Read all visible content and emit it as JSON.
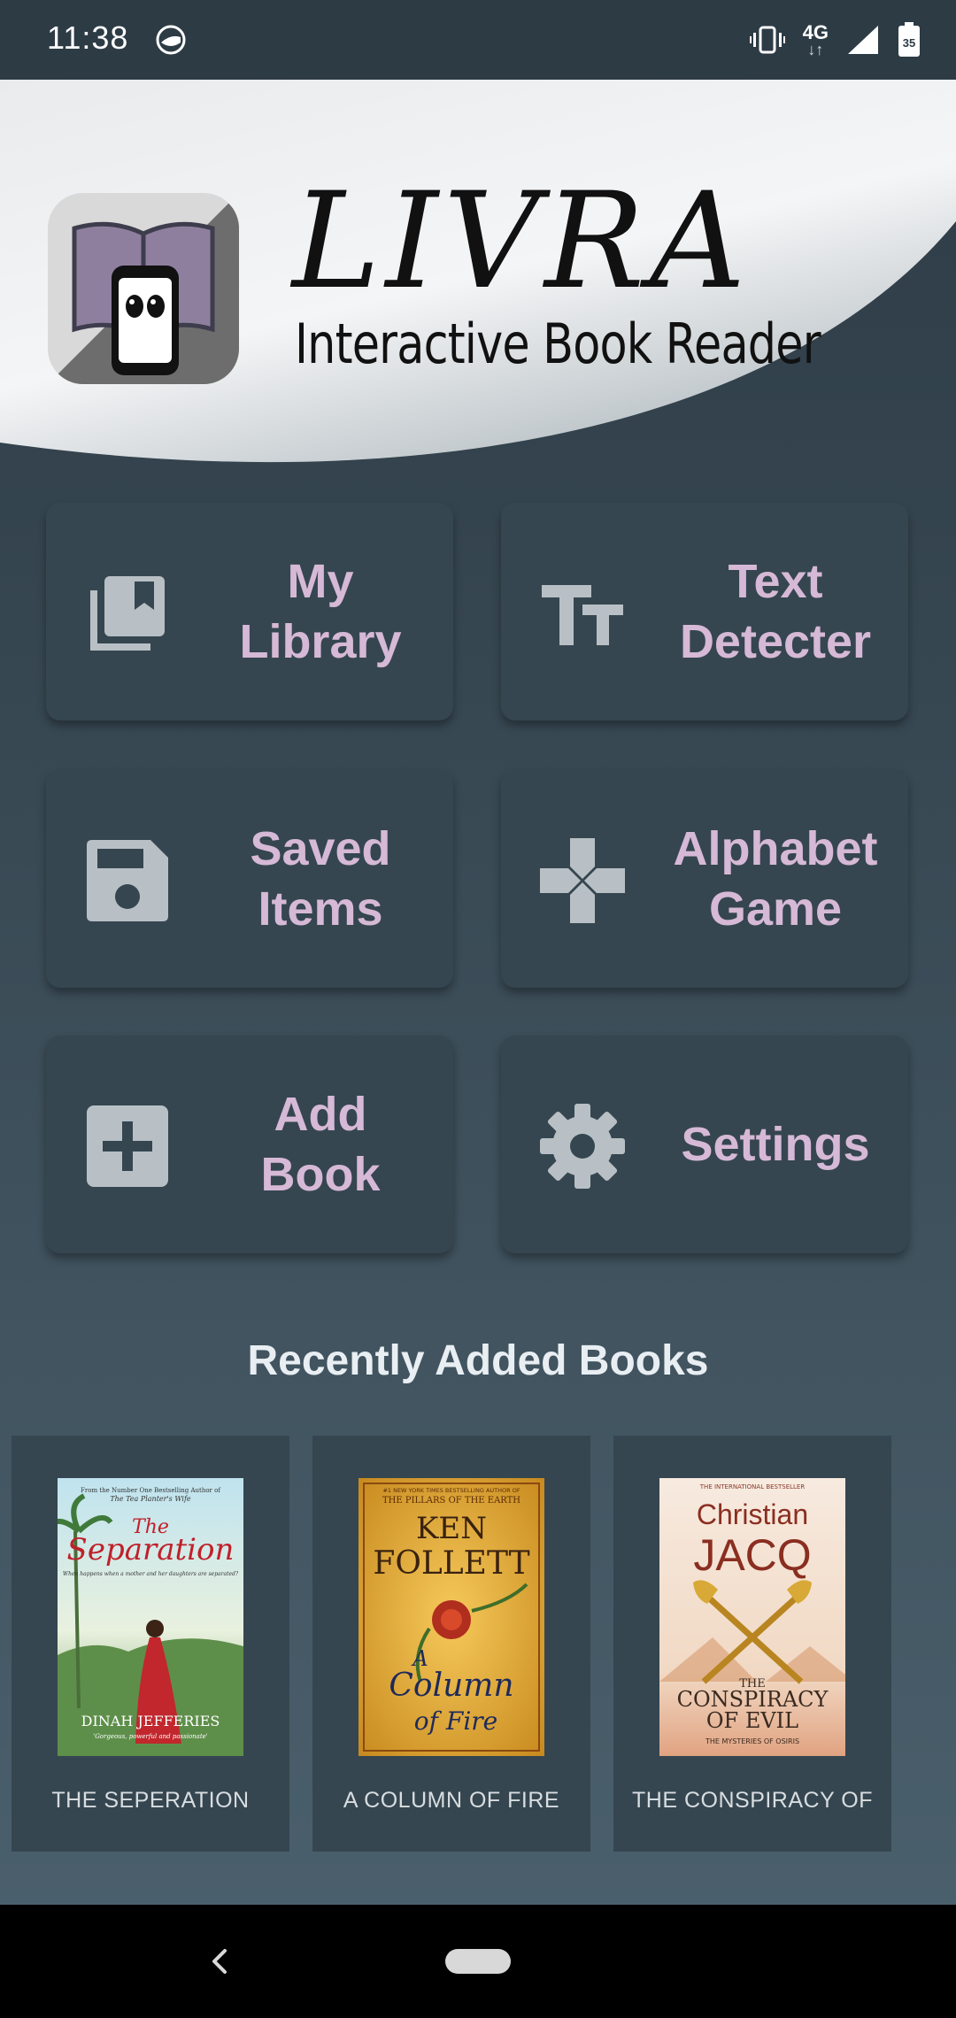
{
  "status_bar": {
    "time": "11:38",
    "network_label": "4G",
    "battery_level": "35",
    "icons": [
      "camera-lens-icon",
      "vibrate-icon",
      "signal-icon",
      "battery-icon"
    ]
  },
  "header": {
    "title": "LIVRA",
    "subtitle": "Interactive Book Reader",
    "logo_icon": "book-reader-logo"
  },
  "menu": {
    "items": [
      {
        "label": "My\nLibrary",
        "icon": "library-icon"
      },
      {
        "label": "Text\nDetecter",
        "icon": "text-size-icon"
      },
      {
        "label": "Saved\nItems",
        "icon": "save-icon"
      },
      {
        "label": "Alphabet\nGame",
        "icon": "gamepad-icon"
      },
      {
        "label": "Add\nBook",
        "icon": "add-box-icon"
      },
      {
        "label": "Settings",
        "icon": "gear-icon"
      }
    ]
  },
  "recent": {
    "title": "Recently Added Books",
    "books": [
      {
        "title": "THE SEPERATION",
        "cover": {
          "top_line": "From the Number One Bestselling Author of",
          "top_line2": "The Tea Planter's Wife",
          "title_line1": "The",
          "title_line2": "Separation",
          "tagline": "When happens when a mother and her daughters are separated?",
          "author": "DINAH JEFFERIES",
          "quote": "'Gorgeous, powerful and passionate'"
        }
      },
      {
        "title": "A COLUMN OF FIRE",
        "cover": {
          "top_line": "#1 NEW YORK TIMES BESTSELLING AUTHOR OF",
          "top_line2": "THE PILLARS OF THE EARTH",
          "author_line1": "KEN",
          "author_line2": "FOLLETT",
          "title_line1": "A",
          "title_line2": "Column",
          "title_line3": "of Fire"
        }
      },
      {
        "title": "THE CONSPIRACY OF",
        "cover": {
          "top_line": "THE INTERNATIONAL BESTSELLER",
          "author_line1": "Christian",
          "author_line2": "JACQ",
          "title_line1": "THE",
          "title_line2": "CONSPIRACY",
          "title_line3": "OF EVIL",
          "series": "THE MYSTERIES OF OSIRIS"
        }
      }
    ]
  },
  "colors": {
    "background": "#2c3a44",
    "tile": "#354650",
    "tile_label": "#d6b9d6",
    "icon": "#b8c0c5"
  }
}
